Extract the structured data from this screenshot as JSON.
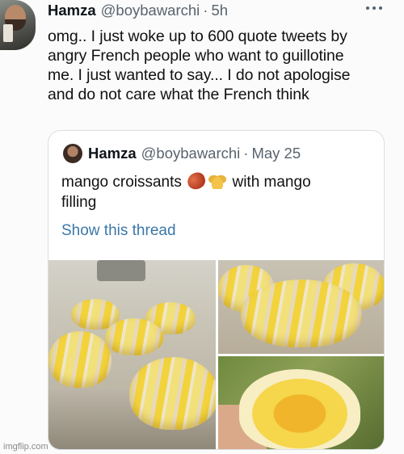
{
  "tweet": {
    "author_name": "Hamza",
    "author_handle": "@boybawarchi",
    "separator": "·",
    "time": "5h",
    "more_icon": "more-horizontal-icon",
    "text": "omg.. I just woke up to 600 quote tweets by\nangry French people who want to guillotine\nme. I just wanted to say... I do not apologise\nand do not care what the French think"
  },
  "quoted_tweet": {
    "author_name": "Hamza",
    "author_handle": "@boybawarchi",
    "separator": "·",
    "date": "May 25",
    "text_before_emoji": "mango croissants",
    "emojis": [
      "mango-emoji",
      "croissant-sparkle-emoji"
    ],
    "text_after_emoji": "with mango",
    "text_line2": "filling",
    "show_thread": "Show this thread",
    "link_color": "#3b77a8",
    "photos": [
      "croissants-on-tray-photo",
      "croissant-closeup-photo",
      "croissant-cut-open-photo"
    ]
  },
  "watermark": "imgflip.com"
}
